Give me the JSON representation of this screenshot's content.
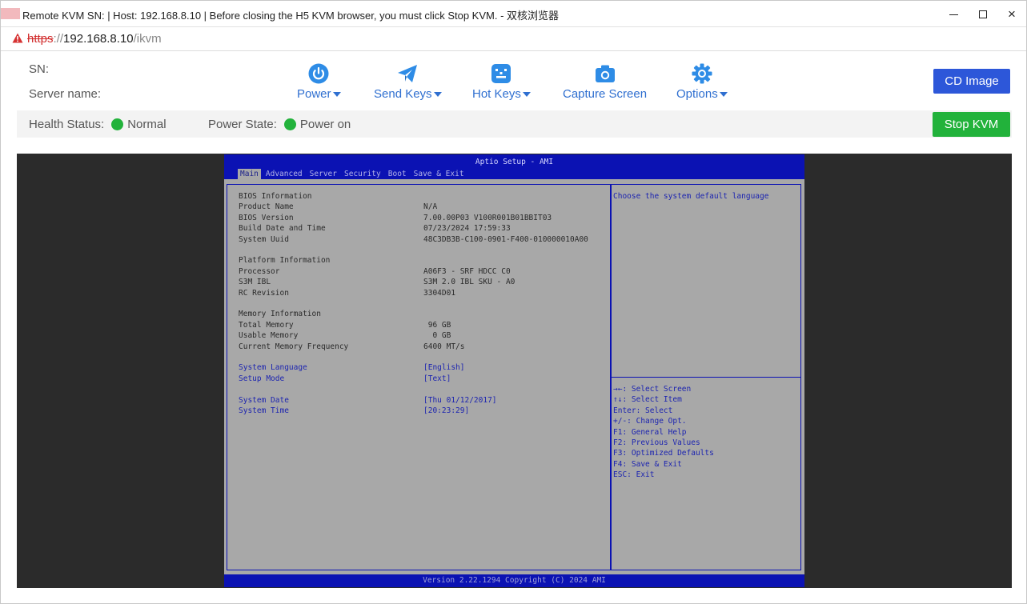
{
  "window": {
    "title": "Remote KVM SN: | Host: 192.168.8.10 | Before closing the H5 KVM browser, you must click Stop KVM. - 双核浏览器",
    "minimize": "minimize",
    "maximize": "maximize",
    "close": "×"
  },
  "address": {
    "scheme": "https",
    "separator": "://",
    "host": "192.168.8.10",
    "path": "/ikvm"
  },
  "info": {
    "sn_label": "SN:",
    "server_name_label": "Server name:"
  },
  "toolbar": {
    "power": "Power",
    "send_keys": "Send Keys",
    "hot_keys": "Hot Keys",
    "capture_screen": "Capture Screen",
    "options": "Options",
    "cd_image": "CD Image",
    "stop_kvm": "Stop KVM"
  },
  "status": {
    "health_label": "Health Status:",
    "health_value": "Normal",
    "power_label": "Power State:",
    "power_value": "Power on",
    "ok_color": "#22b23b"
  },
  "bios": {
    "title": "Aptio Setup - AMI",
    "tabs": [
      "Main",
      "Advanced",
      "Server",
      "Security",
      "Boot",
      "Save & Exit"
    ],
    "rows": [
      {
        "label": "BIOS Information",
        "value": "",
        "blue": false
      },
      {
        "label": "Product Name",
        "value": "N/A",
        "blue": false
      },
      {
        "label": "BIOS Version",
        "value": "7.00.00P03 V100R001B01BBIT03",
        "blue": false
      },
      {
        "label": "Build Date and Time",
        "value": "07/23/2024 17:59:33",
        "blue": false
      },
      {
        "label": "System Uuid",
        "value": "48C3DB3B-C100-0901-F400-010000010A00",
        "blue": false
      },
      {
        "label": "Platform Information",
        "value": "",
        "blue": false
      },
      {
        "label": "Processor",
        "value": "A06F3 - SRF HDCC C0",
        "blue": false
      },
      {
        "label": "S3M IBL",
        "value": "S3M 2.0 IBL SKU - A0",
        "blue": false
      },
      {
        "label": "RC Revision",
        "value": "3304D01",
        "blue": false
      },
      {
        "label": "Memory Information",
        "value": "",
        "blue": false
      },
      {
        "label": "Total Memory",
        "value": " 96 GB",
        "blue": false
      },
      {
        "label": "Usable Memory",
        "value": "  0 GB",
        "blue": false
      },
      {
        "label": "Current Memory Frequency",
        "value": "6400 MT/s",
        "blue": false
      },
      {
        "label": "System Language",
        "value": "[English]",
        "blue": true
      },
      {
        "label": "Setup Mode",
        "value": "[Text]",
        "blue": true
      },
      {
        "label": "System Date",
        "value": "[Thu 01/12/2017]",
        "blue": true
      },
      {
        "label": "System Time",
        "value": "[20:23:29]",
        "blue": true
      }
    ],
    "help": "Choose the system default language",
    "keys": [
      "→←: Select Screen",
      "↑↓: Select Item",
      "Enter: Select",
      "+/-: Change Opt.",
      "F1: General Help",
      "F2: Previous Values",
      "F3: Optimized Defaults",
      "F4: Save & Exit",
      "ESC: Exit"
    ],
    "footer": "Version 2.22.1294 Copyright (C) 2024 AMI"
  }
}
